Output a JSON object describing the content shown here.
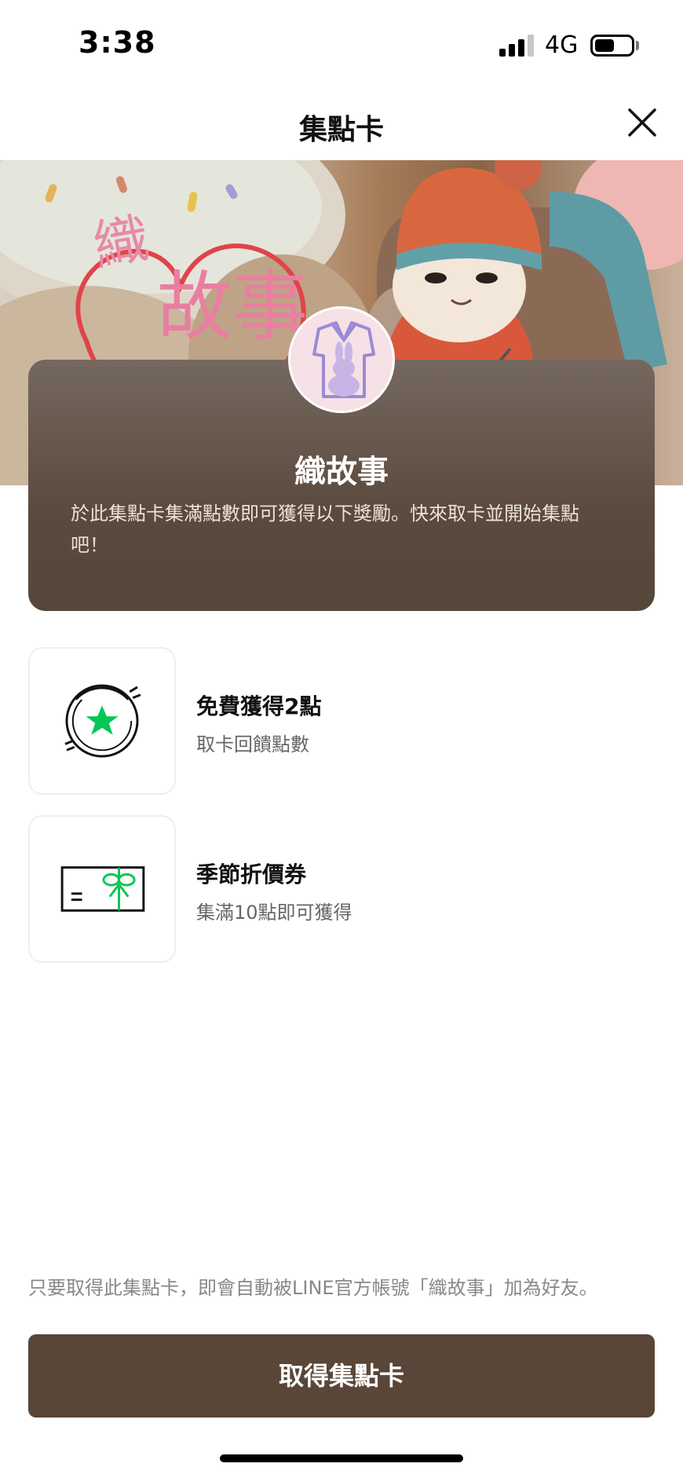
{
  "status_bar": {
    "time": "3:38",
    "network": "4G",
    "battery_level": 0.55
  },
  "header": {
    "title": "集點卡",
    "close_icon": "close-icon"
  },
  "card": {
    "shop_name": "織故事",
    "description": "於此集點卡集滿點數即可獲得以下獎勵。快來取卡並開始集點吧！",
    "background_color": "#5b4a3e"
  },
  "rewards": [
    {
      "icon": "star-stamp-icon",
      "title": "免費獲得2點",
      "subtitle": "取卡回饋點數"
    },
    {
      "icon": "gift-voucher-icon",
      "title": "季節折價券",
      "subtitle": "集滿10點即可獲得"
    }
  ],
  "footer": {
    "note": "只要取得此集點卡，即會自動被LINE官方帳號「織故事」加為好友。",
    "button_label": "取得集點卡"
  },
  "colors": {
    "accent_green": "#06c755",
    "button_brown": "#594638"
  }
}
